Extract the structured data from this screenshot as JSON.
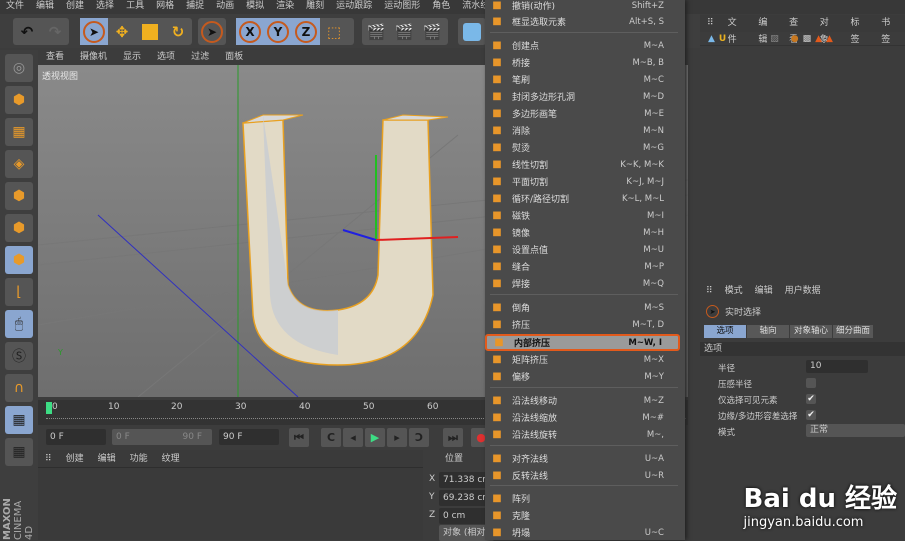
{
  "menubar": [
    "文件",
    "编辑",
    "创建",
    "选择",
    "工具",
    "网格",
    "捕捉",
    "动画",
    "模拟",
    "渲染",
    "雕刻",
    "运动跟踪",
    "运动图形",
    "角色",
    "流水线"
  ],
  "toolbar": {
    "x": "X",
    "y": "Y",
    "z": "Z"
  },
  "viewport": {
    "menu": [
      "查看",
      "摄像机",
      "显示",
      "选项",
      "过滤",
      "面板"
    ],
    "label": "透视视图",
    "object_letter": "U"
  },
  "timeline": {
    "ticks": [
      "0",
      "10",
      "20",
      "30",
      "40",
      "50",
      "60"
    ],
    "start": "0 F",
    "range_start": "0 F",
    "range_end": "90 F",
    "end": "90 F"
  },
  "material": {
    "menu": [
      "创建",
      "编辑",
      "功能",
      "纹理"
    ]
  },
  "coords": {
    "title": "位置",
    "x_label": "X",
    "x": "71.338 cm",
    "y_label": "Y",
    "y": "69.238 cm",
    "z_label": "Z",
    "z": "0 cm",
    "mode": "对象 (相对"
  },
  "brand": {
    "maxon": "MAXON",
    "c4d": "CINEMA 4D"
  },
  "context_menu": [
    {
      "label": "撤销(动作)",
      "shortcut": "Shift+Z",
      "icon": "undo-icon"
    },
    {
      "label": "框显选取元素",
      "shortcut": "Alt+S, S",
      "icon": "frame-selected-icon"
    },
    {
      "label": "创建点",
      "shortcut": "M~A",
      "icon": "create-point-icon"
    },
    {
      "label": "桥接",
      "shortcut": "M~B, B",
      "icon": "bridge-icon"
    },
    {
      "label": "笔刷",
      "shortcut": "M~C",
      "icon": "brush-icon"
    },
    {
      "label": "封闭多边形孔洞",
      "shortcut": "M~D",
      "icon": "close-hole-icon"
    },
    {
      "label": "多边形画笔",
      "shortcut": "M~E",
      "icon": "polygon-pen-icon"
    },
    {
      "label": "消除",
      "shortcut": "M~N",
      "icon": "dissolve-icon"
    },
    {
      "label": "熨烫",
      "shortcut": "M~G",
      "icon": "iron-icon"
    },
    {
      "label": "线性切割",
      "shortcut": "K~K, M~K",
      "icon": "knife-icon"
    },
    {
      "label": "平面切割",
      "shortcut": "K~J, M~J",
      "icon": "plane-cut-icon"
    },
    {
      "label": "循环/路径切割",
      "shortcut": "K~L, M~L",
      "icon": "loop-cut-icon"
    },
    {
      "label": "磁铁",
      "shortcut": "M~I",
      "icon": "magnet-icon"
    },
    {
      "label": "镜像",
      "shortcut": "M~H",
      "icon": "mirror-icon"
    },
    {
      "label": "设置点值",
      "shortcut": "M~U",
      "icon": "set-point-icon"
    },
    {
      "label": "缝合",
      "shortcut": "M~P",
      "icon": "stitch-icon"
    },
    {
      "label": "焊接",
      "shortcut": "M~Q",
      "icon": "weld-icon"
    },
    {
      "label": "倒角",
      "shortcut": "M~S",
      "icon": "bevel-icon"
    },
    {
      "label": "挤压",
      "shortcut": "M~T, D",
      "icon": "extrude-icon"
    },
    {
      "label": "内部挤压",
      "shortcut": "M~W, I",
      "icon": "extrude-inner-icon"
    },
    {
      "label": "矩阵挤压",
      "shortcut": "M~X",
      "icon": "matrix-extrude-icon"
    },
    {
      "label": "偏移",
      "shortcut": "M~Y",
      "icon": "offset-icon"
    },
    {
      "label": "沿法线移动",
      "shortcut": "M~Z",
      "icon": "normal-move-icon"
    },
    {
      "label": "沿法线缩放",
      "shortcut": "M~#",
      "icon": "normal-scale-icon"
    },
    {
      "label": "沿法线旋转",
      "shortcut": "M~,",
      "icon": "normal-rotate-icon"
    },
    {
      "label": "对齐法线",
      "shortcut": "U~A",
      "icon": "align-normals-icon"
    },
    {
      "label": "反转法线",
      "shortcut": "U~R",
      "icon": "reverse-normals-icon"
    },
    {
      "label": "阵列",
      "shortcut": "",
      "icon": "array-icon"
    },
    {
      "label": "克隆",
      "shortcut": "",
      "icon": "clone-icon"
    },
    {
      "label": "坍塌",
      "shortcut": "U~C",
      "icon": "collapse-icon"
    }
  ],
  "object_manager": {
    "menu": [
      "文件",
      "编辑",
      "查看",
      "对象",
      "标签",
      "书签"
    ],
    "object_name": "U"
  },
  "attributes": {
    "menu": [
      "模式",
      "编辑",
      "用户数据"
    ],
    "tool": "实时选择",
    "tabs": [
      "选项",
      "轴向",
      "对象轴心",
      "细分曲面"
    ],
    "section": "选项",
    "radius_label": "半径",
    "radius": "10",
    "pressure_label": "压感半径",
    "visible_only_label": "仅选择可见元素",
    "tolerance_label": "边缘/多边形容差选择",
    "mode_label": "模式",
    "mode": "正常"
  },
  "watermark": {
    "brand": "Bai du 经验",
    "url": "jingyan.baidu.com"
  },
  "colors": {
    "accent": "#e25a1c",
    "selected": "#8aa6d0"
  }
}
